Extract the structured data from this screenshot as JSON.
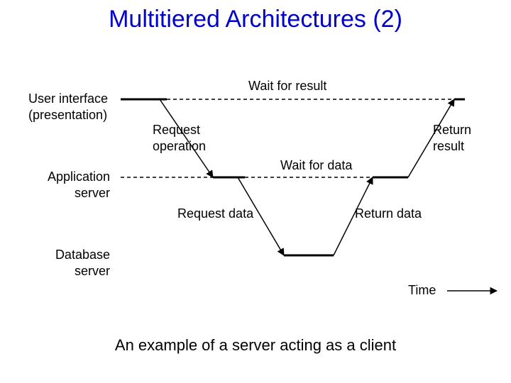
{
  "title": "Multitiered Architectures (2)",
  "caption": "An example of a server acting as a client",
  "tiers": {
    "ui": {
      "line1": "User interface",
      "line2": "(presentation)"
    },
    "app": {
      "line1": "Application",
      "line2": "server"
    },
    "db": {
      "line1": "Database",
      "line2": "server"
    }
  },
  "labels": {
    "wait_result": "Wait for result",
    "wait_data": "Wait for data",
    "request_operation_l1": "Request",
    "request_operation_l2": "operation",
    "request_data": "Request data",
    "return_data": "Return data",
    "return_result_l1": "Return",
    "return_result_l2": "result",
    "time": "Time"
  },
  "diagram_data": {
    "tiers": [
      "User interface (presentation)",
      "Application server",
      "Database server"
    ],
    "y": {
      "ui": 80,
      "app": 190,
      "db": 300
    },
    "x_range": [
      170,
      650
    ],
    "events": [
      {
        "type": "active",
        "tier": "ui",
        "x0": 170,
        "x1": 235
      },
      {
        "type": "request",
        "from": "ui",
        "to": "app",
        "x0": 225,
        "x1": 300,
        "label": "Request operation"
      },
      {
        "type": "wait",
        "tier": "ui",
        "x0": 235,
        "x1": 640,
        "label": "Wait for result"
      },
      {
        "type": "active",
        "tier": "app",
        "x0": 300,
        "x1": 345
      },
      {
        "type": "request",
        "from": "app",
        "to": "db",
        "x0": 335,
        "x1": 400,
        "label": "Request data"
      },
      {
        "type": "wait",
        "tier": "app",
        "x0": 345,
        "x1": 525,
        "label": "Wait for data"
      },
      {
        "type": "active",
        "tier": "db",
        "x0": 400,
        "x1": 470
      },
      {
        "type": "return",
        "from": "db",
        "to": "app",
        "x0": 470,
        "x1": 525,
        "label": "Return data"
      },
      {
        "type": "active",
        "tier": "app",
        "x0": 525,
        "x1": 575
      },
      {
        "type": "return",
        "from": "app",
        "to": "ui",
        "x0": 575,
        "x1": 640,
        "label": "Return result"
      },
      {
        "type": "active",
        "tier": "ui",
        "x0": 640,
        "x1": 650
      }
    ]
  }
}
